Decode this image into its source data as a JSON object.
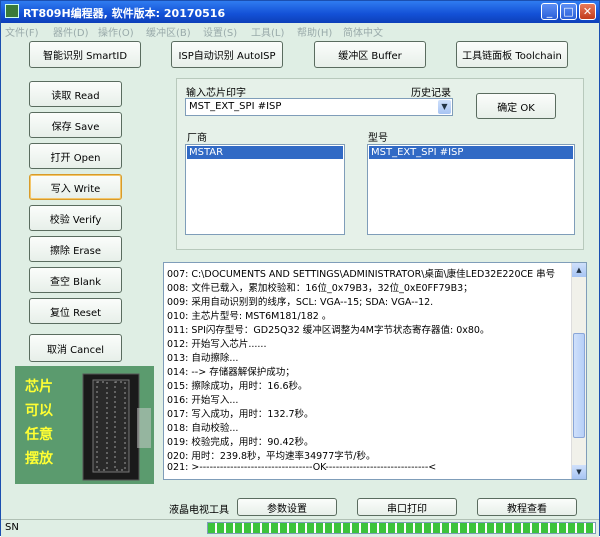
{
  "window": {
    "title": "RT809H编程器, 软件版本: 20170516",
    "min": "_",
    "max": "□",
    "close": "✕"
  },
  "menu": [
    "文件(F)",
    "器件(D)",
    "操作(O)",
    "缓冲区(B)",
    "设置(S)",
    "工具(L)",
    "帮助(H)",
    "简体中文"
  ],
  "top_buttons": {
    "smartid": "智能识别 SmartID",
    "autoisp": "ISP自动识别 AutoISP",
    "buffer": "缓冲区 Buffer",
    "toolchain": "工具链面板 Toolchain"
  },
  "left_buttons": [
    "读取 Read",
    "保存 Save",
    "打开 Open",
    "写入 Write",
    "校验 Verify",
    "擦除 Erase",
    "查空 Blank",
    "复位 Reset"
  ],
  "cancel_label": "取消 Cancel",
  "chip": {
    "label_input": "输入芯片印字",
    "history": "历史记录",
    "selected": "MST_EXT_SPI #ISP",
    "ok": "确定 OK"
  },
  "vendor": {
    "label": "厂商",
    "items": [
      "MSTAR"
    ]
  },
  "model": {
    "label": "型号",
    "items": [
      "MST_EXT_SPI #ISP"
    ]
  },
  "log": [
    "007:  C:\\DOCUMENTS AND SETTINGS\\ADMINISTRATOR\\桌面\\康佳LED32E220CE 串号",
    "008:  文件已载入，累加校验和：16位_0x79B3，32位_0xE0FF79B3；",
    "009:  采用自动识别到的线序，SCL: VGA--15; SDA: VGA--12.",
    "010:  主芯片型号: MST6M181/182 。",
    "011:  SPI闪存型号：GD25Q32 缓冲区调整为4M字节状态寄存器值: 0x80。",
    "012:  开始写入芯片......",
    "013:  自动擦除...",
    "014:  --> 存储器解保护成功；",
    "015:  擦除成功，用时：16.6秒。",
    "016:  开始写入...",
    "017:  写入成功，用时：132.7秒。",
    "018:  自动校验...",
    "019:  校验完成，用时：90.42秒。",
    "020:  用时：239.8秒，平均速率34977字节/秒。",
    "021:  >---------------------------------OK------------------------------<"
  ],
  "chip_photo": {
    "lines": [
      "芯片",
      "可以",
      "任意",
      "摆放"
    ]
  },
  "bottom": {
    "tv_tools": "液晶电视工具",
    "params": "参数设置",
    "serial": "串口打印",
    "tutorial": "教程查看"
  },
  "status": {
    "sn": "SN",
    "progress_percent": 100
  }
}
